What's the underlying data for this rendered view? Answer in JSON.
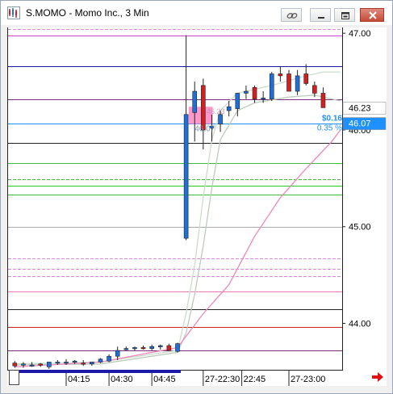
{
  "window": {
    "title": "S.MOMO - Momo Inc., 3 Min",
    "buttons": [
      "link-icon",
      "minimize-icon",
      "restore-icon",
      "close-icon"
    ]
  },
  "chart_data": {
    "type": "candlestick",
    "ylim": [
      43.52,
      47.06
    ],
    "y_ticks": [
      "47.00",
      "46.00",
      "45.00",
      "44.00"
    ],
    "y_tick_values": [
      47.0,
      46.0,
      45.0,
      44.0
    ],
    "x_ticks": [
      "04:15",
      "04:30",
      "04:45",
      "27-22:30",
      "22:45",
      "27-23:00"
    ],
    "x_tick_index": [
      6.5,
      11.5,
      16.5,
      22.5,
      27,
      32.5
    ],
    "price_labels": [
      {
        "text": "46.23",
        "value": 46.23,
        "bg": "#ffffff",
        "color": "#000000"
      },
      {
        "text": "46.07",
        "value": 46.07,
        "bg": "#1e90ff",
        "color": "#ffffff"
      }
    ],
    "annotations": {
      "change": "$0.16",
      "change_pct": "0.35 %",
      "price_shadow": "46.07",
      "box_price": "46.23"
    },
    "horizontal_lines": [
      {
        "value": 47.04,
        "color": "#dd88dd",
        "style": "dashed"
      },
      {
        "value": 46.98,
        "color": "#cc44cc",
        "style": "solid"
      },
      {
        "value": 46.66,
        "color": "#1a1aaa",
        "style": "solid"
      },
      {
        "value": 46.32,
        "color": "#7a2f7a",
        "style": "solid"
      },
      {
        "value": 46.07,
        "color": "#cc2222",
        "style": "solid"
      },
      {
        "value": 46.07,
        "color": "#1e90ff",
        "style": "solid"
      },
      {
        "value": 45.87,
        "color": "#222222",
        "style": "solid"
      },
      {
        "value": 45.66,
        "color": "#44bb44",
        "style": "solid"
      },
      {
        "value": 45.49,
        "color": "#44bb44",
        "style": "dashed"
      },
      {
        "value": 45.42,
        "color": "#22cc22",
        "style": "solid"
      },
      {
        "value": 45.33,
        "color": "#44bb44",
        "style": "solid"
      },
      {
        "value": 45.0,
        "color": "#aaaaaa",
        "style": "solid"
      },
      {
        "value": 44.67,
        "color": "#dd88dd",
        "style": "dashed"
      },
      {
        "value": 44.56,
        "color": "#dd88dd",
        "style": "dashed"
      },
      {
        "value": 44.49,
        "color": "#dd88dd",
        "style": "dashed"
      },
      {
        "value": 44.33,
        "color": "#ee77bb",
        "style": "solid"
      },
      {
        "value": 44.15,
        "color": "#222222",
        "style": "solid"
      },
      {
        "value": 43.96,
        "color": "#cc2222",
        "style": "solid"
      },
      {
        "value": 43.72,
        "color": "#7a2f7a",
        "style": "solid"
      }
    ],
    "bar_count": 39,
    "candles": [
      {
        "i": 0,
        "o": 43.59,
        "h": 43.61,
        "l": 43.54,
        "c": 43.56
      },
      {
        "i": 1,
        "o": 43.57,
        "h": 43.6,
        "l": 43.54,
        "c": 43.58
      },
      {
        "i": 2,
        "o": 43.57,
        "h": 43.6,
        "l": 43.55,
        "c": 43.57
      },
      {
        "i": 3,
        "o": 43.58,
        "h": 43.59,
        "l": 43.55,
        "c": 43.57
      },
      {
        "i": 4,
        "o": 43.55,
        "h": 43.6,
        "l": 43.53,
        "c": 43.6
      },
      {
        "i": 5,
        "o": 43.6,
        "h": 43.62,
        "l": 43.57,
        "c": 43.6
      },
      {
        "i": 6,
        "o": 43.6,
        "h": 43.63,
        "l": 43.57,
        "c": 43.6
      },
      {
        "i": 7,
        "o": 43.6,
        "h": 43.62,
        "l": 43.58,
        "c": 43.61
      },
      {
        "i": 8,
        "o": 43.59,
        "h": 43.62,
        "l": 43.56,
        "c": 43.58
      },
      {
        "i": 9,
        "o": 43.58,
        "h": 43.6,
        "l": 43.56,
        "c": 43.6
      },
      {
        "i": 10,
        "o": 43.6,
        "h": 43.64,
        "l": 43.59,
        "c": 43.63
      },
      {
        "i": 11,
        "o": 43.61,
        "h": 43.68,
        "l": 43.6,
        "c": 43.66
      },
      {
        "i": 12,
        "o": 43.66,
        "h": 43.76,
        "l": 43.62,
        "c": 43.72
      },
      {
        "i": 13,
        "o": 43.74,
        "h": 43.76,
        "l": 43.72,
        "c": 43.74
      },
      {
        "i": 14,
        "o": 43.74,
        "h": 43.76,
        "l": 43.72,
        "c": 43.75
      },
      {
        "i": 15,
        "o": 43.75,
        "h": 43.77,
        "l": 43.73,
        "c": 43.74
      },
      {
        "i": 16,
        "o": 43.74,
        "h": 43.78,
        "l": 43.72,
        "c": 43.76
      },
      {
        "i": 17,
        "o": 43.76,
        "h": 43.78,
        "l": 43.73,
        "c": 43.77
      },
      {
        "i": 18,
        "o": 43.77,
        "h": 43.79,
        "l": 43.72,
        "c": 43.72
      },
      {
        "i": 19,
        "o": 43.71,
        "h": 43.8,
        "l": 43.7,
        "c": 43.79
      },
      {
        "i": 20,
        "o": 44.88,
        "h": 46.98,
        "l": 44.86,
        "c": 46.16
      },
      {
        "i": 21,
        "o": 46.18,
        "h": 46.5,
        "l": 45.88,
        "c": 46.4
      },
      {
        "i": 22,
        "o": 46.46,
        "h": 46.53,
        "l": 45.8,
        "c": 46.0
      },
      {
        "i": 23,
        "o": 46.02,
        "h": 46.16,
        "l": 45.88,
        "c": 46.04
      },
      {
        "i": 24,
        "o": 46.06,
        "h": 46.2,
        "l": 45.98,
        "c": 46.16
      },
      {
        "i": 25,
        "o": 46.2,
        "h": 46.3,
        "l": 46.14,
        "c": 46.24
      },
      {
        "i": 26,
        "o": 46.22,
        "h": 46.38,
        "l": 46.14,
        "c": 46.38
      },
      {
        "i": 27,
        "o": 46.38,
        "h": 46.46,
        "l": 46.32,
        "c": 46.4
      },
      {
        "i": 28,
        "o": 46.44,
        "h": 46.46,
        "l": 46.28,
        "c": 46.32
      },
      {
        "i": 29,
        "o": 46.32,
        "h": 46.4,
        "l": 46.28,
        "c": 46.33
      },
      {
        "i": 30,
        "o": 46.32,
        "h": 46.6,
        "l": 46.3,
        "c": 46.58
      },
      {
        "i": 31,
        "o": 46.58,
        "h": 46.66,
        "l": 46.5,
        "c": 46.56
      },
      {
        "i": 32,
        "o": 46.58,
        "h": 46.62,
        "l": 46.44,
        "c": 46.4
      },
      {
        "i": 33,
        "o": 46.4,
        "h": 46.62,
        "l": 46.36,
        "c": 46.56
      },
      {
        "i": 34,
        "o": 46.58,
        "h": 46.68,
        "l": 46.46,
        "c": 46.48
      },
      {
        "i": 35,
        "o": 46.46,
        "h": 46.5,
        "l": 46.34,
        "c": 46.38
      },
      {
        "i": 36,
        "o": 46.38,
        "h": 46.44,
        "l": 46.3,
        "c": 46.23
      }
    ],
    "moving_averages": [
      {
        "color": "#ccddcc",
        "values": [
          [
            0,
            43.58
          ],
          [
            10,
            43.6
          ],
          [
            19,
            43.72
          ],
          [
            20,
            44.1
          ],
          [
            21,
            44.6
          ],
          [
            22,
            45.3
          ],
          [
            23,
            45.9
          ],
          [
            24,
            46.2
          ],
          [
            26,
            46.38
          ],
          [
            30,
            46.46
          ],
          [
            34,
            46.56
          ],
          [
            36,
            46.6
          ],
          [
            38,
            46.6
          ]
        ]
      },
      {
        "color": "#bbccbb",
        "values": [
          [
            0,
            43.57
          ],
          [
            10,
            43.58
          ],
          [
            19,
            43.7
          ],
          [
            20,
            43.9
          ],
          [
            21,
            44.3
          ],
          [
            22,
            44.8
          ],
          [
            23,
            45.4
          ],
          [
            24,
            45.9
          ],
          [
            26,
            46.2
          ],
          [
            28,
            46.28
          ],
          [
            32,
            46.34
          ],
          [
            35,
            46.36
          ],
          [
            38,
            46.3
          ]
        ]
      },
      {
        "color": "#ee88bb",
        "values": [
          [
            0,
            43.55
          ],
          [
            10,
            43.6
          ],
          [
            19,
            43.75
          ],
          [
            22,
            44.1
          ],
          [
            25,
            44.4
          ],
          [
            28,
            44.9
          ],
          [
            31,
            45.3
          ],
          [
            34,
            45.6
          ],
          [
            37,
            45.88
          ],
          [
            38,
            46.0
          ]
        ]
      }
    ],
    "highlight_box": {
      "x0": 20.3,
      "x1": 23.1,
      "y0": 46.24,
      "y1": 46.06,
      "color": "#ff77bb"
    }
  }
}
